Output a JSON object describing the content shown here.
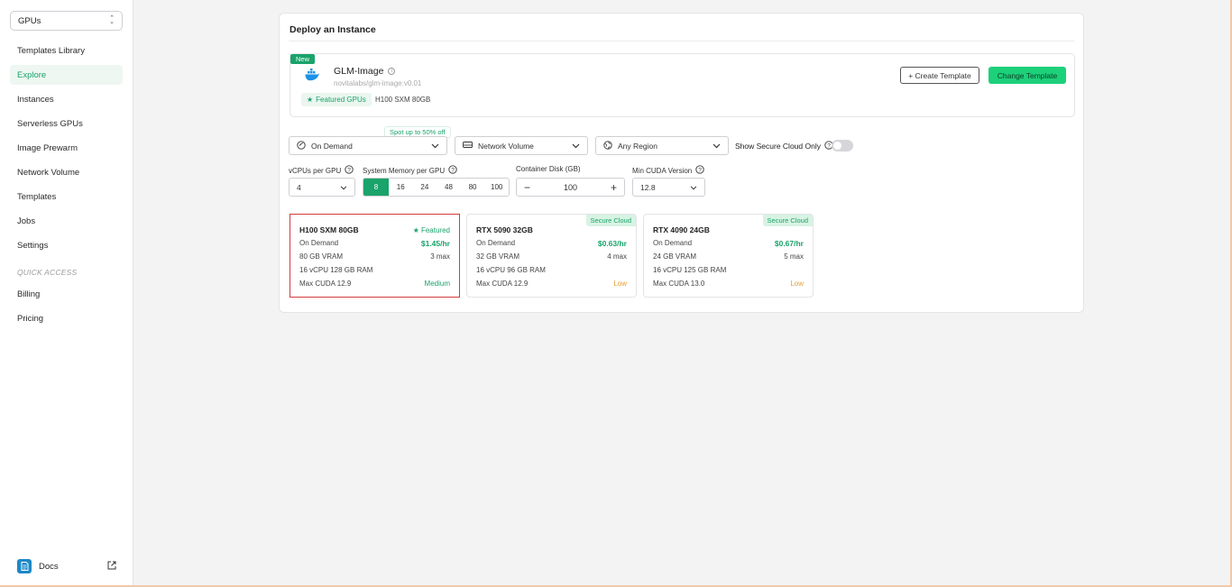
{
  "sidebar": {
    "selector": "GPUs",
    "items": [
      {
        "label": "Templates Library"
      },
      {
        "label": "Explore"
      },
      {
        "label": "Instances"
      },
      {
        "label": "Serverless GPUs"
      },
      {
        "label": "Image Prewarm"
      },
      {
        "label": "Network Volume"
      },
      {
        "label": "Templates"
      },
      {
        "label": "Jobs"
      },
      {
        "label": "Settings"
      }
    ],
    "active_item": "Explore",
    "quick_access_label": "QUICK ACCESS",
    "quick_items": [
      {
        "label": "Billing"
      },
      {
        "label": "Pricing"
      }
    ],
    "docs_label": "Docs"
  },
  "panel": {
    "title": "Deploy an Instance",
    "template": {
      "badge": "New",
      "name": "GLM-Image",
      "path": "novitalabs/glm-image:v0.01",
      "featured_label": "Featured GPUs",
      "gpu": "H100 SXM 80GB",
      "create_button": "+ Create Template",
      "change_button": "Change Template"
    },
    "filters": {
      "billing": "On Demand",
      "spot_tag": "Spot up to 50% off",
      "volume": "Network Volume",
      "region": "Any Region",
      "secure_cloud_label": "Show Secure Cloud Only",
      "secure_cloud_on": false
    },
    "config": {
      "vcpu_label": "vCPUs per GPU",
      "vcpu_value": "4",
      "memory_label": "System Memory per GPU",
      "memory_options": [
        "8",
        "16",
        "24",
        "48",
        "80",
        "100"
      ],
      "memory_selected": "8",
      "disk_label": "Container Disk (GB)",
      "disk_value": "100",
      "cuda_label": "Min CUDA Version",
      "cuda_value": "12.8"
    },
    "gpus": [
      {
        "name": "H100 SXM 80GB",
        "tag": "Featured",
        "billing": "On Demand",
        "price": "$1.45/hr",
        "vram": "80 GB VRAM",
        "max": "3 max",
        "specs": "16 vCPU 128 GB RAM",
        "cuda": "Max CUDA 12.9",
        "availability": "Medium",
        "selected": true
      },
      {
        "name": "RTX 5090 32GB",
        "tag": "Secure Cloud",
        "billing": "On Demand",
        "price": "$0.63/hr",
        "vram": "32 GB VRAM",
        "max": "4 max",
        "specs": "16 vCPU 96 GB RAM",
        "cuda": "Max CUDA 12.9",
        "availability": "Low",
        "selected": false
      },
      {
        "name": "RTX 4090 24GB",
        "tag": "Secure Cloud",
        "billing": "On Demand",
        "price": "$0.67/hr",
        "vram": "24 GB VRAM",
        "max": "5 max",
        "specs": "16 vCPU 125 GB RAM",
        "cuda": "Max CUDA 13.0",
        "availability": "Low",
        "selected": false
      }
    ]
  },
  "colors": {
    "accent": "#1aa36a",
    "button_green": "#1dd07a",
    "selected_border": "#d33a3a",
    "low_availability": "#e7a03a"
  }
}
